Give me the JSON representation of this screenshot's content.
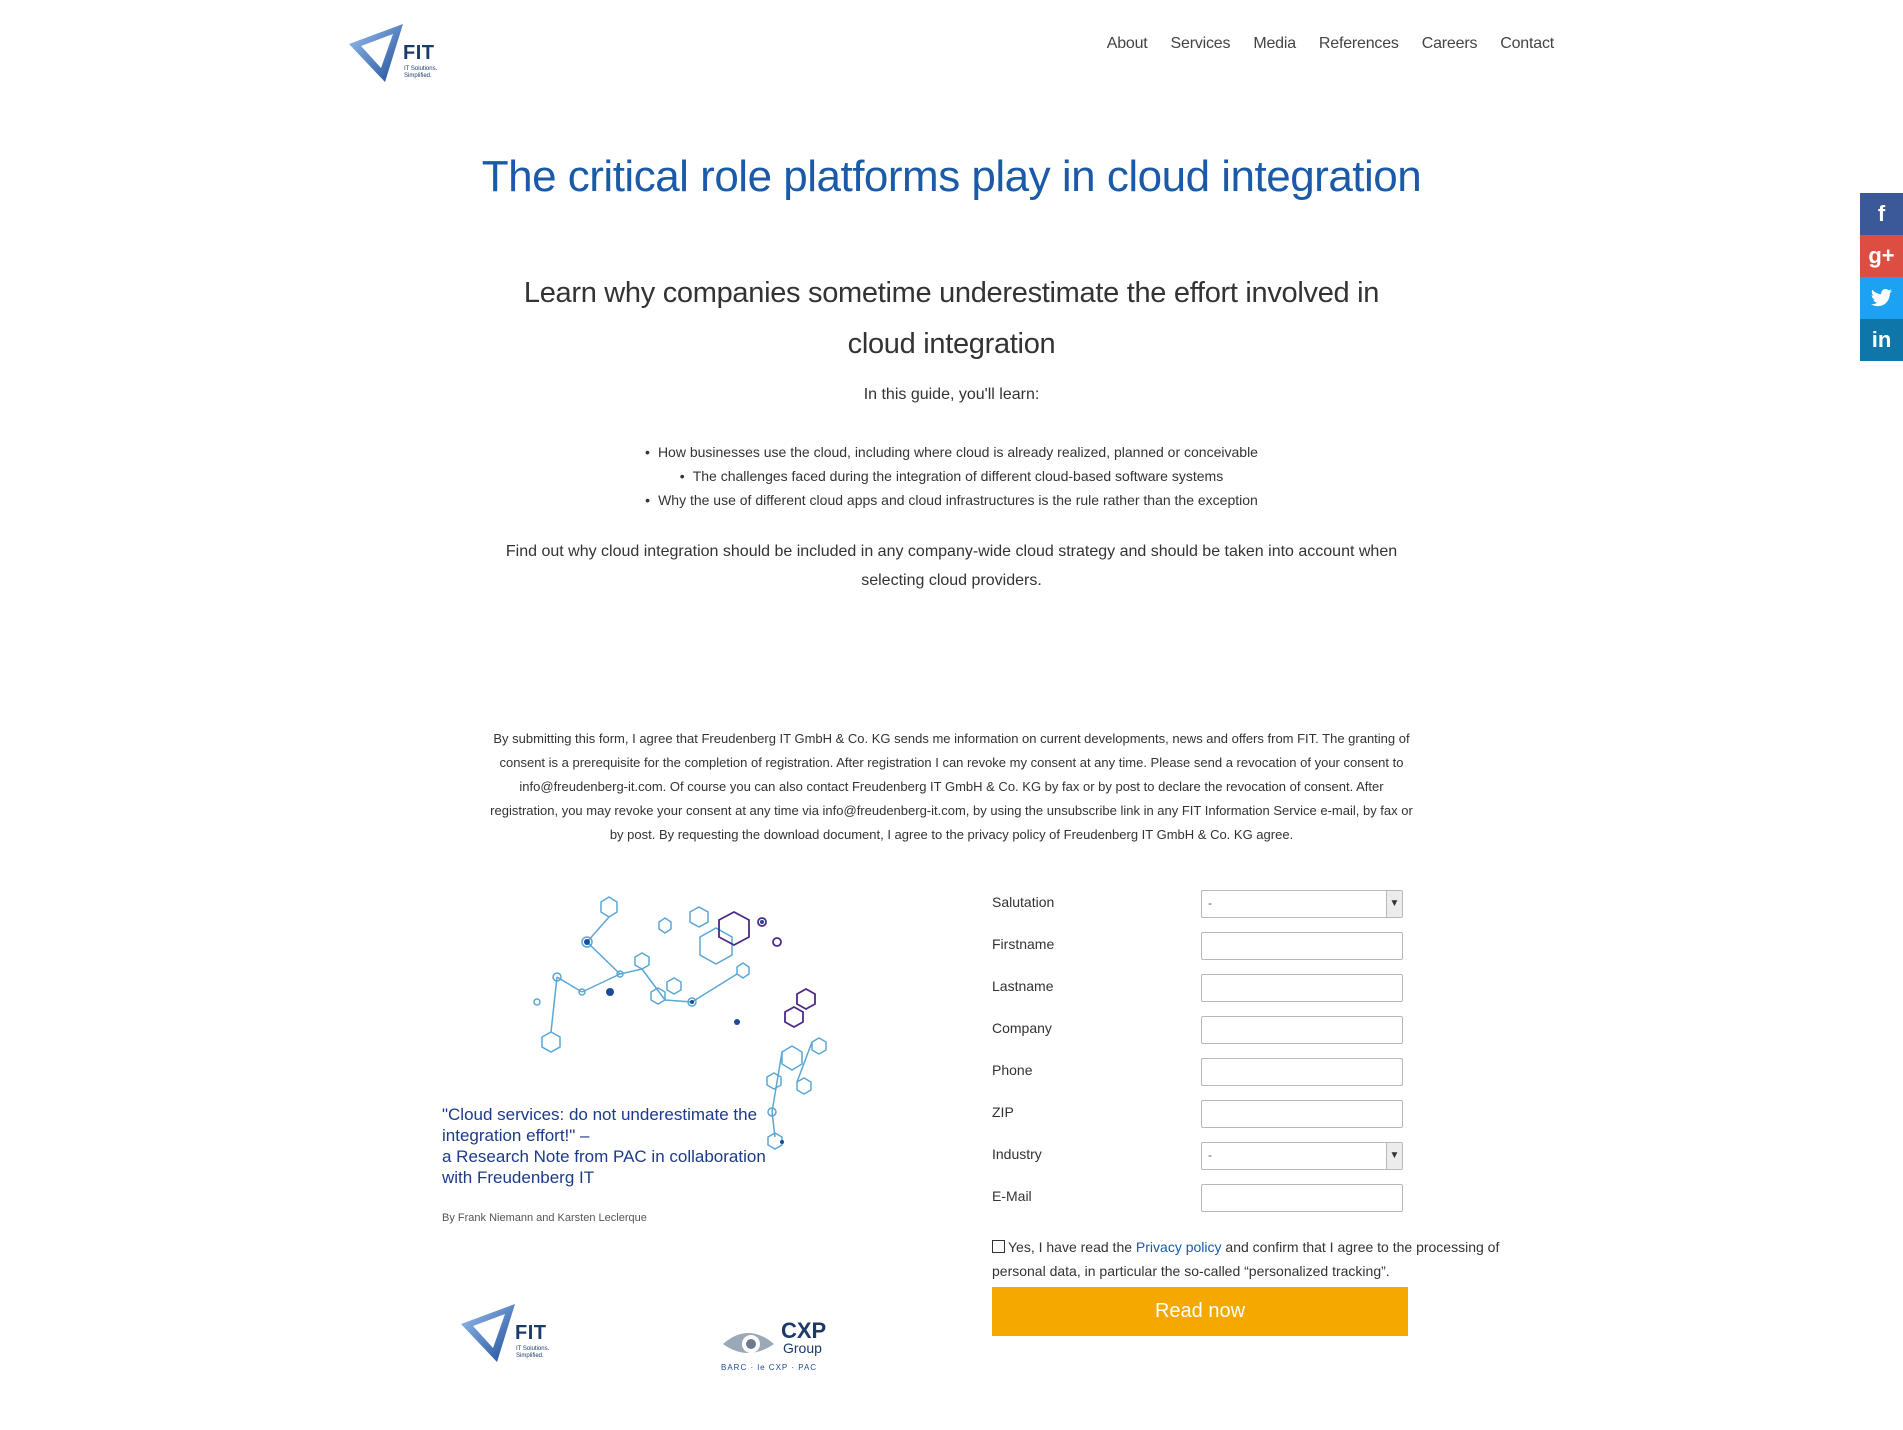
{
  "logo": {
    "name": "FIT",
    "tagline": "IT Solutions. Simplified."
  },
  "nav": [
    "About",
    "Services",
    "Media",
    "References",
    "Careers",
    "Contact"
  ],
  "social": {
    "facebook": "f",
    "googleplus": "g+",
    "twitter": "t",
    "linkedin": "in"
  },
  "title": "The critical role platforms play in cloud integration",
  "subtitle": "Learn why companies sometime underestimate the effort involved in cloud integration",
  "intro": "In this guide, you'll learn:",
  "bullets": [
    "How businesses use the cloud, including where cloud is already realized, planned or conceivable",
    "The challenges faced during the integration of different cloud-based software systems",
    "Why the use of different cloud apps and cloud infrastructures is the rule rather than the exception"
  ],
  "findout": "Find out why cloud integration should be included in any company-wide cloud strategy and should be taken into account when selecting cloud providers.",
  "consent": "By submitting this form, I agree that Freudenberg IT GmbH & Co. KG sends me information on current developments, news and offers from FIT. The granting of consent is a prerequisite for the completion of registration. After registration I can revoke my consent at any time. Please send a revocation of your consent to info@freudenberg-it.com. Of course you can also contact Freudenberg IT GmbH & Co. KG by fax or by post to declare the revocation of consent. After registration, you may revoke your consent at any time via info@freudenberg-it.com, by using the unsubscribe link in any FIT Information Service e-mail, by fax or by post. By requesting the download document, I agree to the privacy policy of Freudenberg IT GmbH & Co. KG agree.",
  "cover": {
    "quote_line1": "\"Cloud services: do not underestimate the integration effort!\" –",
    "quote_line2": "a Research Note from PAC in collaboration with Freudenberg IT",
    "author": "By Frank Niemann and Karsten Leclerque",
    "fit_logo": "FIT",
    "fit_tagline": "IT Solutions. Simplified.",
    "cxp_logo": "CXP",
    "cxp_group": "Group",
    "cxp_sub": "BARC · le CXP · PAC"
  },
  "form": {
    "salutation_label": "Salutation",
    "salutation_value": "-",
    "firstname_label": "Firstname",
    "lastname_label": "Lastname",
    "company_label": "Company",
    "phone_label": "Phone",
    "zip_label": "ZIP",
    "industry_label": "Industry",
    "industry_value": "-",
    "email_label": "E-Mail",
    "checkbox_text_before": "Yes, I have read the ",
    "privacy_link": "Privacy policy",
    "checkbox_text_after": " and confirm that I agree to the processing of personal data, in particular the so-called “personalized tracking”.",
    "submit_label": "Read now"
  },
  "colors": {
    "title_blue": "#1a5aa8",
    "button": "#f5a800"
  }
}
